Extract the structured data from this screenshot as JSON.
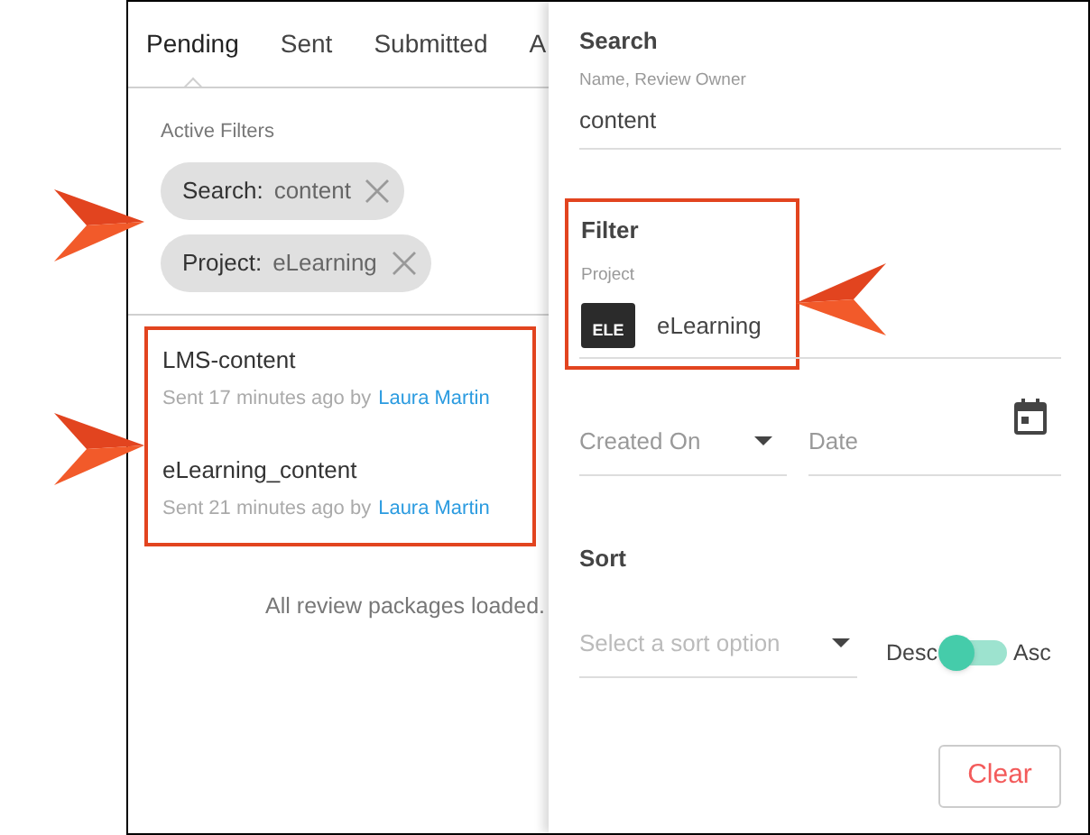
{
  "tabs": [
    {
      "label": "Pending",
      "selected": true
    },
    {
      "label": "Sent",
      "selected": false
    },
    {
      "label": "Submitted",
      "selected": false
    },
    {
      "label": "A",
      "selected": false
    }
  ],
  "active_filters": {
    "title": "Active Filters",
    "chips": [
      {
        "label": "Search:",
        "value": "content"
      },
      {
        "label": "Project:",
        "value": "eLearning"
      }
    ]
  },
  "packages": [
    {
      "name": "LMS-content",
      "sent": "Sent 17 minutes ago by",
      "owner": "Laura Martin"
    },
    {
      "name": "eLearning_content",
      "sent": "Sent 21 minutes ago by",
      "owner": "Laura Martin"
    }
  ],
  "status": "All review packages loaded.",
  "search": {
    "title": "Search",
    "label": "Name, Review Owner",
    "value": "content"
  },
  "filter": {
    "title": "Filter",
    "label": "Project",
    "project_badge": "ELE",
    "project": "eLearning"
  },
  "date_filter": {
    "field": "Created On",
    "placeholder": "Date"
  },
  "sort": {
    "title": "Sort",
    "placeholder": "Select a sort option",
    "desc_label": "Desc",
    "asc_label": "Asc",
    "ascending": false
  },
  "clear_button": "Clear"
}
